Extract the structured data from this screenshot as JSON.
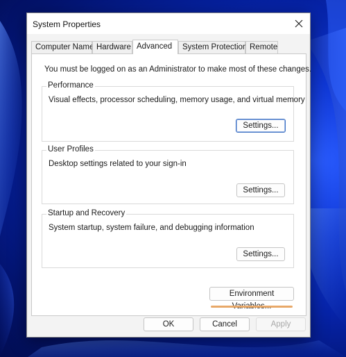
{
  "dialog": {
    "title": "System Properties",
    "close_label": "Close"
  },
  "tabs": [
    {
      "label": "Computer Name",
      "active": false
    },
    {
      "label": "Hardware",
      "active": false
    },
    {
      "label": "Advanced",
      "active": true
    },
    {
      "label": "System Protection",
      "active": false
    },
    {
      "label": "Remote",
      "active": false
    }
  ],
  "advanced": {
    "notice": "You must be logged on as an Administrator to make most of these changes.",
    "performance": {
      "label": "Performance",
      "description": "Visual effects, processor scheduling, memory usage, and virtual memory",
      "button": "Settings..."
    },
    "user_profiles": {
      "label": "User Profiles",
      "description": "Desktop settings related to your sign-in",
      "button": "Settings..."
    },
    "startup_recovery": {
      "label": "Startup and Recovery",
      "description": "System startup, system failure, and debugging information",
      "button": "Settings..."
    },
    "env_button": "Environment Variables..."
  },
  "footer": {
    "ok": "OK",
    "cancel": "Cancel",
    "apply": "Apply"
  },
  "colors": {
    "wallpaper": "#0a2fc4",
    "highlight_underline": "#e8a868",
    "focus_border": "#3b6fc2"
  }
}
